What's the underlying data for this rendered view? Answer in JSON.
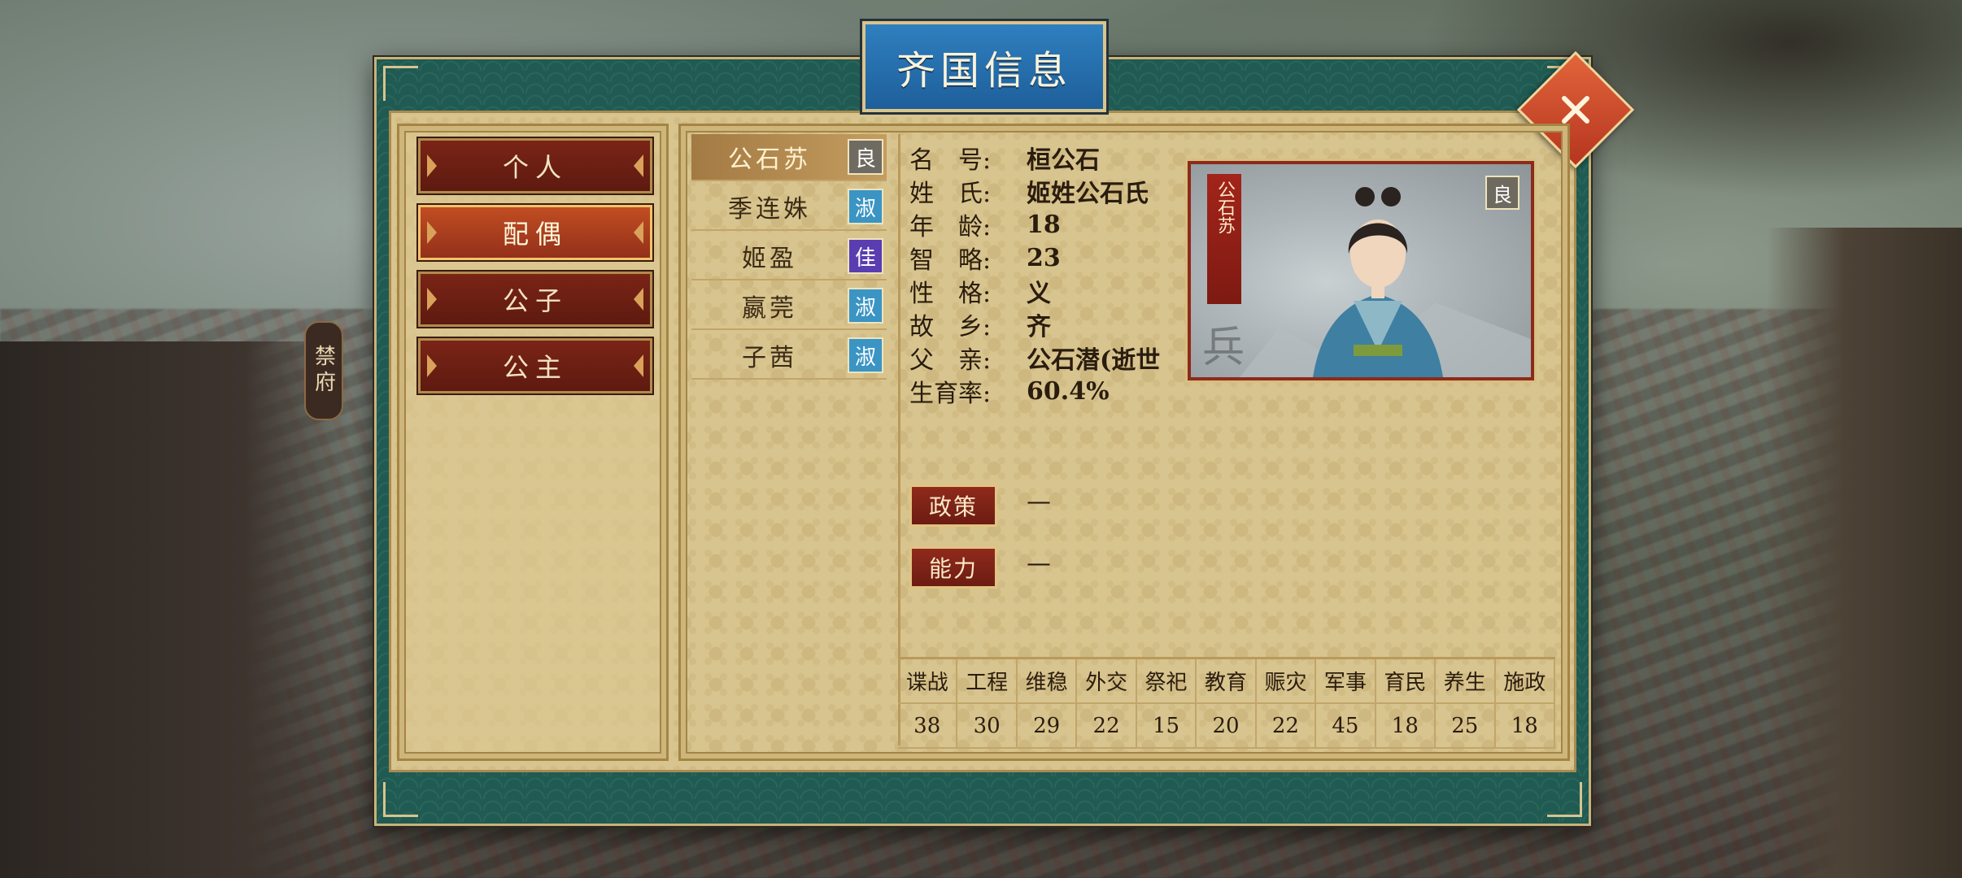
{
  "title": "齐国信息",
  "side_tab": "禁府",
  "menu": [
    {
      "label": "个人",
      "active": false
    },
    {
      "label": "配偶",
      "active": true
    },
    {
      "label": "公子",
      "active": false
    },
    {
      "label": "公主",
      "active": false
    }
  ],
  "spouses": [
    {
      "name": "公石苏",
      "rank": "良",
      "rank_color": "#6f6b62",
      "active": true
    },
    {
      "name": "季连姝",
      "rank": "淑",
      "rank_color": "#3a94c4",
      "active": false
    },
    {
      "name": "姬盈",
      "rank": "佳",
      "rank_color": "#5a3db0",
      "active": false
    },
    {
      "name": "嬴莞",
      "rank": "淑",
      "rank_color": "#3a94c4",
      "active": false
    },
    {
      "name": "子茜",
      "rank": "淑",
      "rank_color": "#3a94c4",
      "active": false
    }
  ],
  "info": [
    {
      "label": "名　号:",
      "value": "桓公石"
    },
    {
      "label": "姓　氏:",
      "value": "姬姓公石氏"
    },
    {
      "label": "年　龄:",
      "value": "18"
    },
    {
      "label": "智　略:",
      "value": "23"
    },
    {
      "label": "性　格:",
      "value": "义"
    },
    {
      "label": "故　乡:",
      "value": "齐"
    },
    {
      "label": "父　亲:",
      "value": "公石潜(逝世"
    },
    {
      "label": "生育率:",
      "value": "60.4%"
    }
  ],
  "portrait": {
    "banner": "公石苏",
    "badge": "良",
    "seal": "兵"
  },
  "policy": {
    "label": "政策",
    "value": "—"
  },
  "ability": {
    "label": "能力",
    "value": "—"
  },
  "stats": {
    "headers": [
      "谍战",
      "工程",
      "维稳",
      "外交",
      "祭祀",
      "教育",
      "赈灾",
      "军事",
      "育民",
      "养生",
      "施政"
    ],
    "values": [
      "38",
      "30",
      "29",
      "22",
      "15",
      "20",
      "22",
      "45",
      "18",
      "25",
      "18"
    ]
  }
}
